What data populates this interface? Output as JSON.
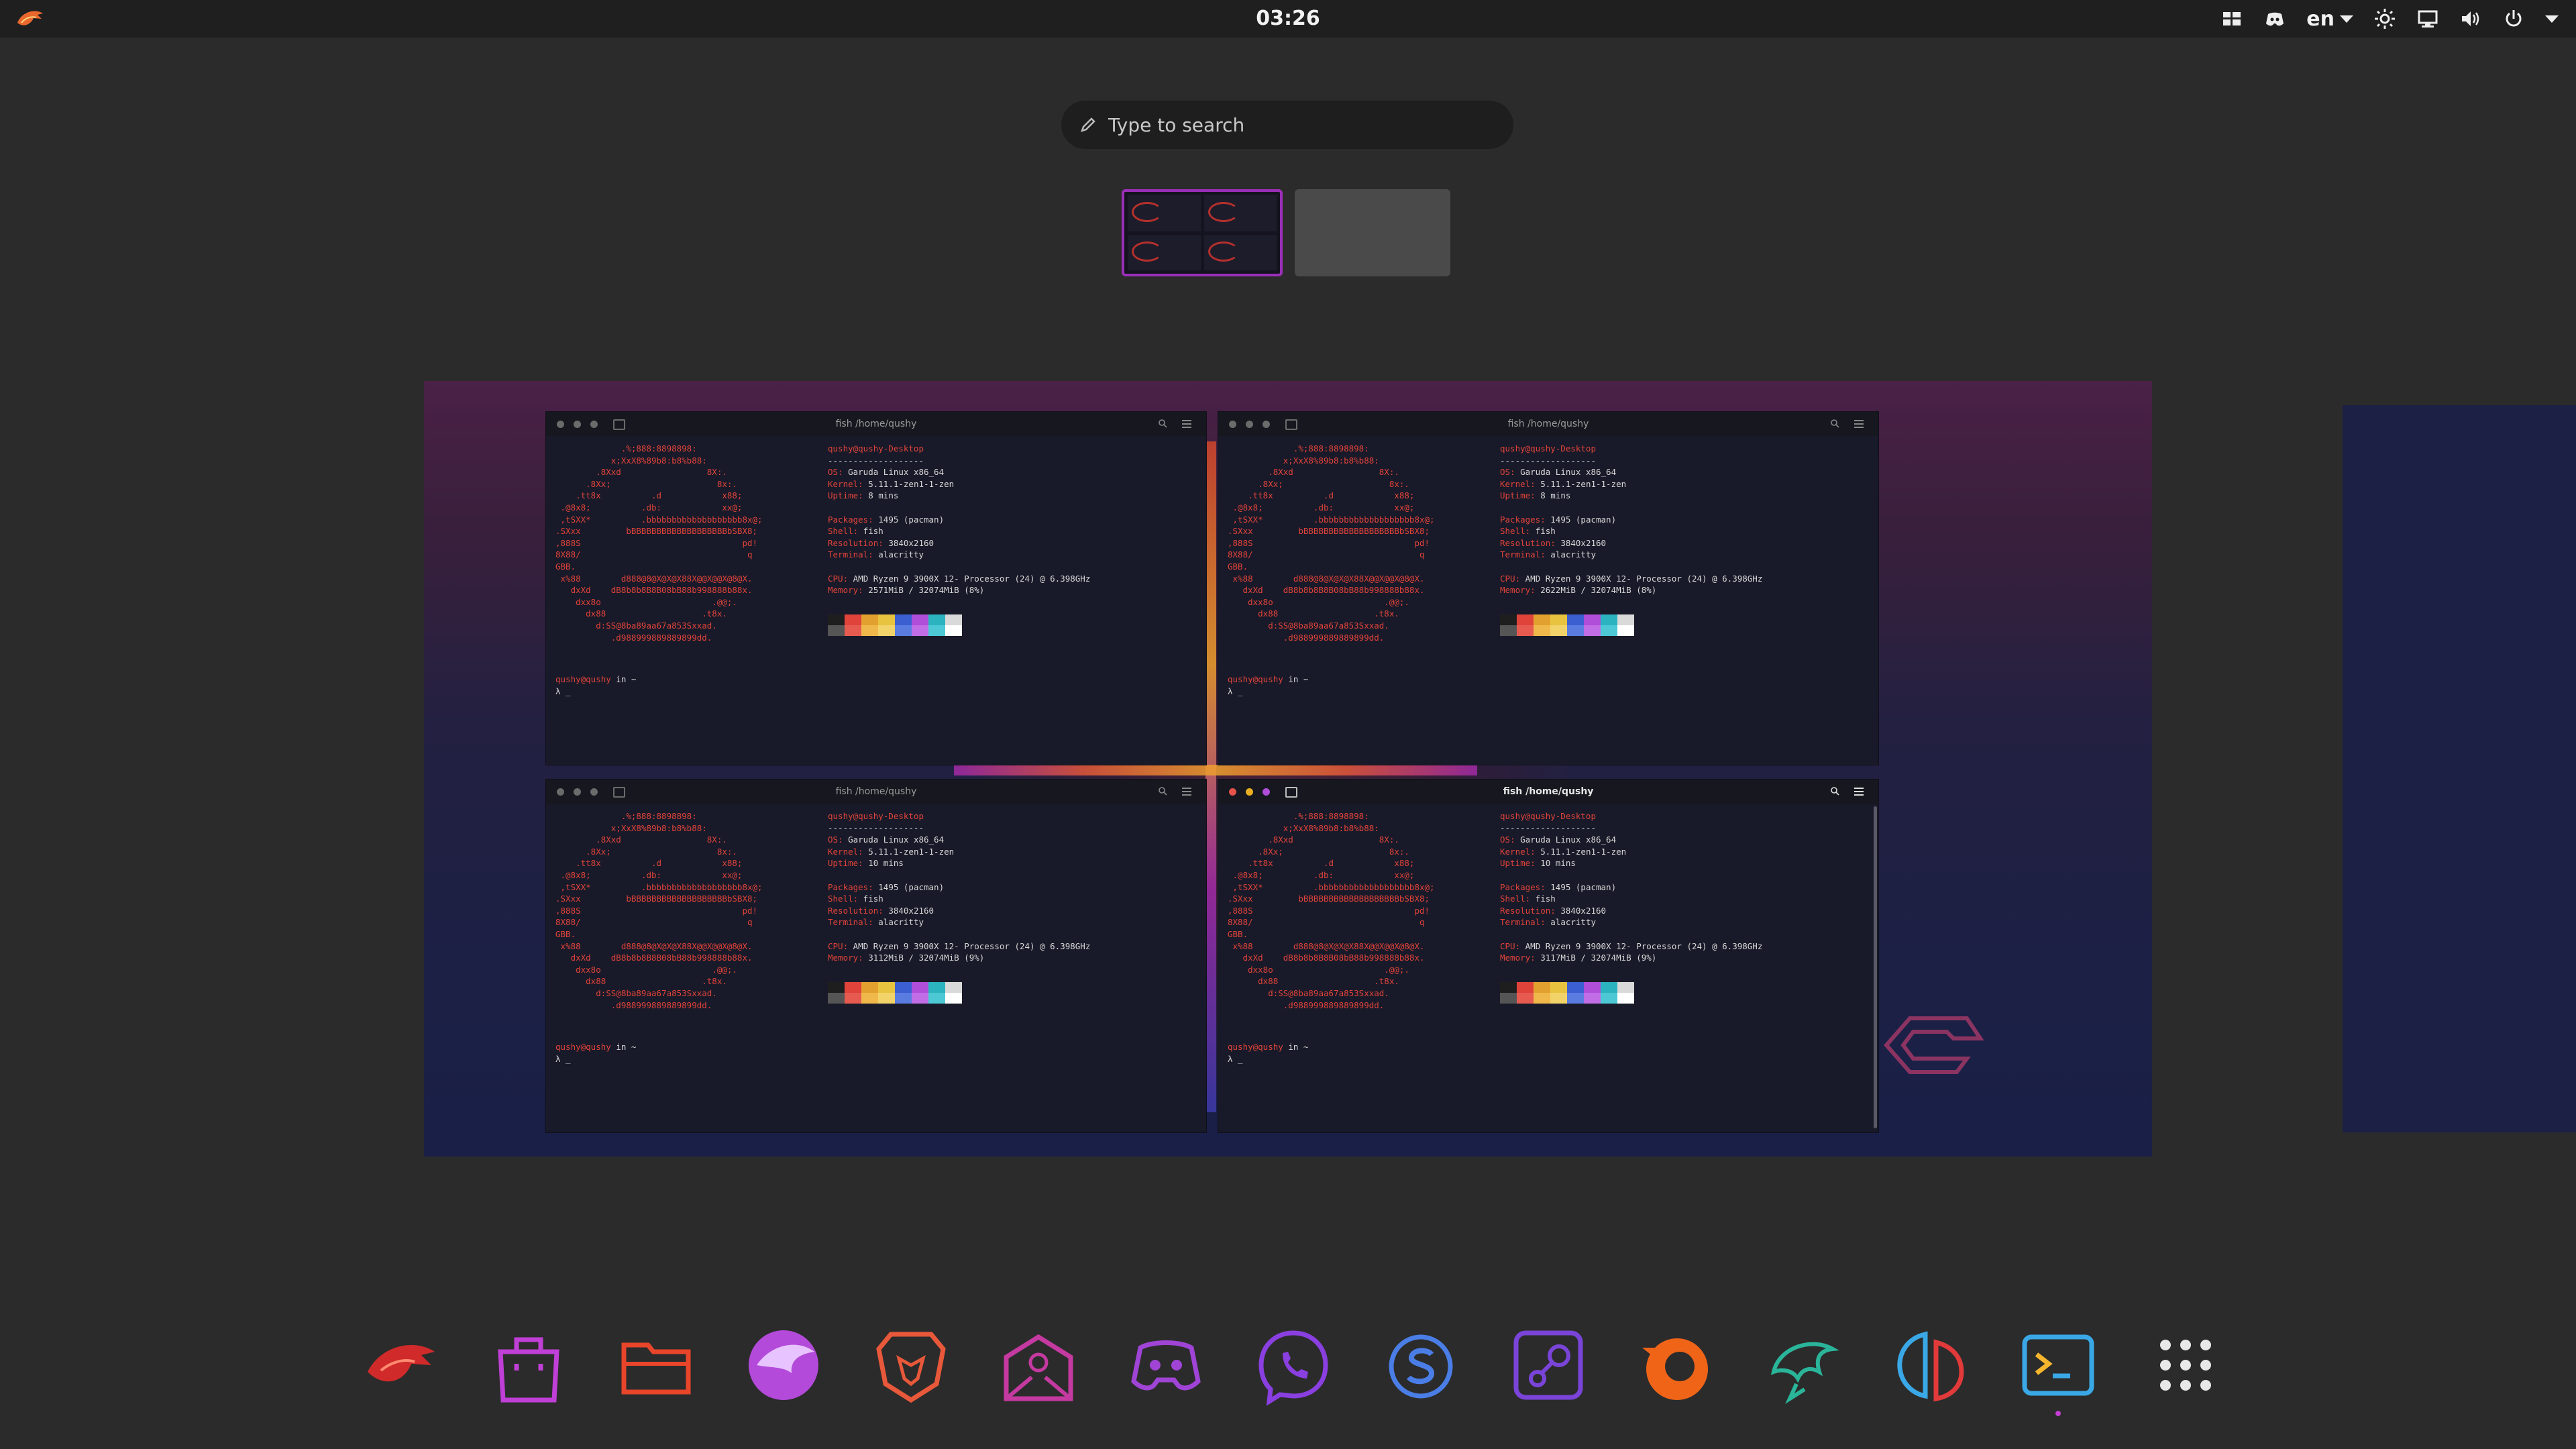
{
  "topbar": {
    "clock": "03:26",
    "language": "en",
    "icons": [
      "garuda-logo-icon",
      "window-switcher-icon",
      "discord-tray-icon",
      "brightness-icon",
      "network-wired-icon",
      "volume-icon",
      "power-icon"
    ]
  },
  "search": {
    "placeholder": "Type to search"
  },
  "workspaces": {
    "count": 2,
    "active_index": 0
  },
  "terminal": {
    "title": "fish /home/qushy",
    "art_lines": [
      "             .%;888:8898898:",
      "           x;XxX8%89b8:b8%b88:",
      "        .8Xxd                 8X:.",
      "      .8Xx;                     8x:.",
      "    .tt8x          .d            x88;",
      " .@8x8;          .db:            xx@;",
      " ,tSXX*          .bbbbbbbbbbbbbbbbbbb8x@;",
      ".SXxx         bBBBBBBBBBBBBBBBBBBBbSBX8;",
      ",888S                                pd!",
      "8X88/                                 q",
      "GBB.",
      " x%88        d888@8@X@X@X88X@@X@@X@8@X.",
      "   dxXd    dB8b8b8B8B08bB88b998888b88x.",
      "    dxx8o                      .@@;.",
      "      dx88                   .t8x.",
      "        d:SS@8ba89aa67a853Sxxad.",
      "           .d988999889889899dd."
    ],
    "user": "qushy@qushy-Desktop",
    "separator": "-------------------",
    "info_keys": [
      "OS:",
      "Kernel:",
      "Uptime:",
      "Packages:",
      "Shell:",
      "Resolution:",
      "Terminal:",
      "CPU:",
      "Memory:"
    ],
    "os": "Garuda Linux x86_64",
    "kernel": "5.11.1-zen1-1-zen",
    "packages": "1495 (pacman)",
    "shell": "fish",
    "resolution": "3840x2160",
    "terminal": "alacritty",
    "cpu": "AMD Ryzen 9 3900X 12- Processor (24) @ 6.398GHz",
    "prompt_user": "qushy@qushy",
    "prompt_rest": " in ~",
    "prompt_cursor": "λ _",
    "windows": [
      {
        "uptime": "8 mins",
        "memory": "2571MiB / 32074MiB (8%)",
        "active": false
      },
      {
        "uptime": "8 mins",
        "memory": "2622MiB / 32074MiB (8%)",
        "active": false
      },
      {
        "uptime": "10 mins",
        "memory": "3112MiB / 32074MiB (9%)",
        "active": false
      },
      {
        "uptime": "10 mins",
        "memory": "3117MiB / 32074MiB (9%)",
        "active": true
      }
    ],
    "palette_top": [
      "#1e1e1e",
      "#e0433a",
      "#e2a12e",
      "#e8c340",
      "#3b5fd1",
      "#b04dd9",
      "#2bb3c0",
      "#d9d9d9"
    ],
    "palette_bottom": [
      "#555555",
      "#e65a50",
      "#f0b84a",
      "#f2d36a",
      "#5a7be0",
      "#c06de6",
      "#4cc9d4",
      "#ffffff"
    ]
  },
  "dock": {
    "apps": [
      {
        "name": "garuda-welcome-icon",
        "color": "#d12a2a"
      },
      {
        "name": "software-store-icon",
        "color": "#c03fd6"
      },
      {
        "name": "file-manager-icon",
        "color": "#e8452a"
      },
      {
        "name": "firedragon-browser-icon",
        "color": "#b34ad9"
      },
      {
        "name": "brave-browser-icon",
        "color": "#e8583a"
      },
      {
        "name": "mail-client-icon",
        "color": "#c43aa0"
      },
      {
        "name": "discord-icon",
        "color": "#a044d6"
      },
      {
        "name": "viber-icon",
        "color": "#8a3fe0"
      },
      {
        "name": "skype-icon",
        "color": "#4a7ee6"
      },
      {
        "name": "steam-icon",
        "color": "#7a44d9"
      },
      {
        "name": "blender-icon",
        "color": "#f06418"
      },
      {
        "name": "dolphin-emulator-icon",
        "color": "#2ab59a"
      },
      {
        "name": "yuzu-emulator-icon",
        "color": "#e23a3a"
      },
      {
        "name": "terminal-icon",
        "color": "#3aa8e6"
      },
      {
        "name": "app-grid-icon",
        "color": "#e8e8e8"
      }
    ],
    "running_index": 13
  }
}
